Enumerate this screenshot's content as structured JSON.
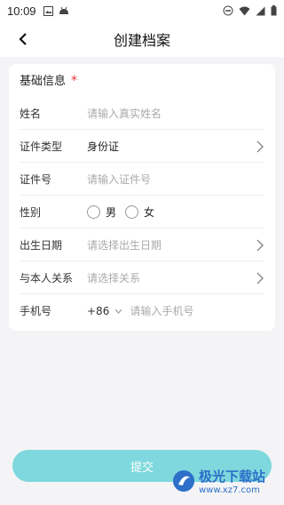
{
  "status_bar": {
    "time": "10:09"
  },
  "nav": {
    "title": "创建档案"
  },
  "form": {
    "section_title": "基础信息",
    "required_mark": "*",
    "rows": [
      {
        "label": "姓名",
        "value": "请输入真实姓名",
        "is_placeholder": true
      },
      {
        "label": "证件类型",
        "value": "身份证",
        "is_placeholder": false
      },
      {
        "label": "证件号",
        "value": "请输入证件号",
        "is_placeholder": true
      },
      {
        "label": "性别",
        "options": [
          "男",
          "女"
        ]
      },
      {
        "label": "出生日期",
        "value": "请选择出生日期",
        "is_placeholder": true
      },
      {
        "label": "与本人关系",
        "value": "请选择关系",
        "is_placeholder": true
      },
      {
        "label": "手机号",
        "country_code": "+86",
        "value": "请输入手机号",
        "is_placeholder": true
      }
    ]
  },
  "submit": {
    "label": "提交",
    "color": "#7ed8dd"
  },
  "watermark": {
    "name": "极光下载站",
    "url": "www.xz7.com"
  }
}
